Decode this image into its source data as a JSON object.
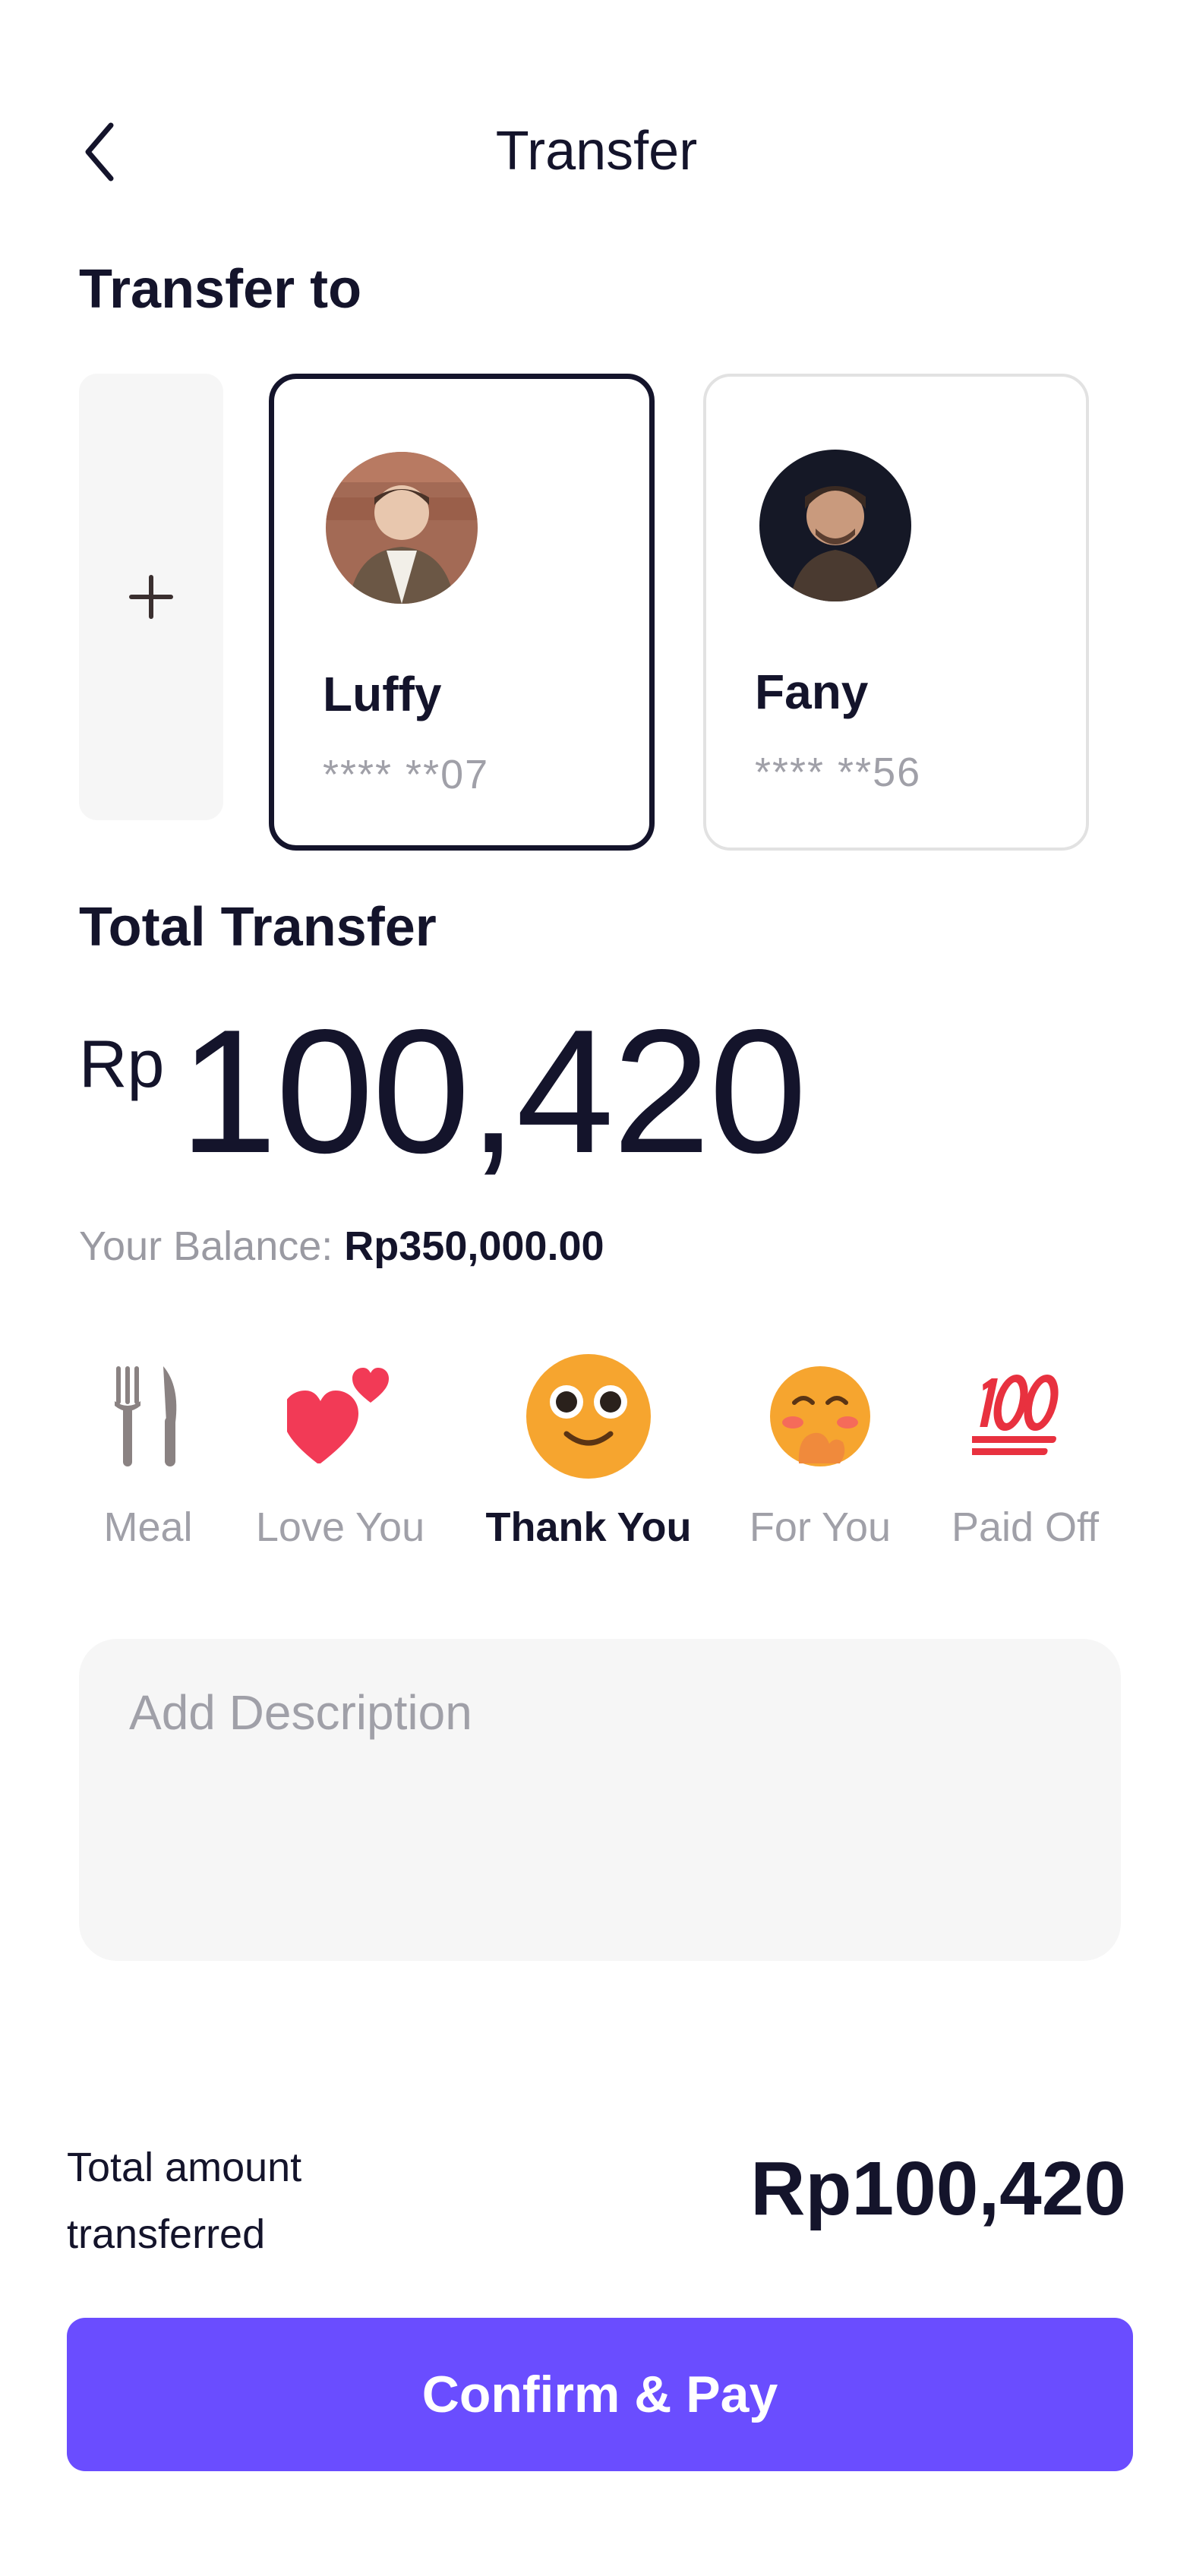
{
  "header": {
    "title": "Transfer",
    "back_icon": "chevron-left-icon"
  },
  "transfer_to": {
    "title": "Transfer to",
    "add_icon": "plus-icon",
    "recipients": [
      {
        "name": "Luffy",
        "account": "**** **07",
        "selected": true,
        "avatar": "user-photo"
      },
      {
        "name": "Fany",
        "account": "**** **56",
        "selected": false,
        "avatar": "user-photo"
      }
    ]
  },
  "total_transfer": {
    "title": "Total Transfer",
    "currency": "Rp",
    "amount": "100,420",
    "balance_label": "Your Balance:",
    "balance_value": "Rp350,000.00"
  },
  "categories": [
    {
      "label": "Meal",
      "icon": "fork-knife-icon",
      "active": false
    },
    {
      "label": "Love You",
      "icon": "two-hearts-icon",
      "active": false
    },
    {
      "label": "Thank You",
      "icon": "smiling-face-icon",
      "active": true
    },
    {
      "label": "For You",
      "icon": "blushing-face-icon",
      "active": false
    },
    {
      "label": "Paid Off",
      "icon": "hundred-points-icon",
      "active": false
    }
  ],
  "description": {
    "placeholder": "Add Description"
  },
  "summary": {
    "label": "Total amount transferred",
    "value": "Rp100,420"
  },
  "confirm_button": {
    "label": "Confirm & Pay"
  },
  "colors": {
    "primary": "#6A4DFF",
    "text_dark": "#14142B",
    "text_muted": "#A0A0A8",
    "surface": "#F6F6F6"
  }
}
